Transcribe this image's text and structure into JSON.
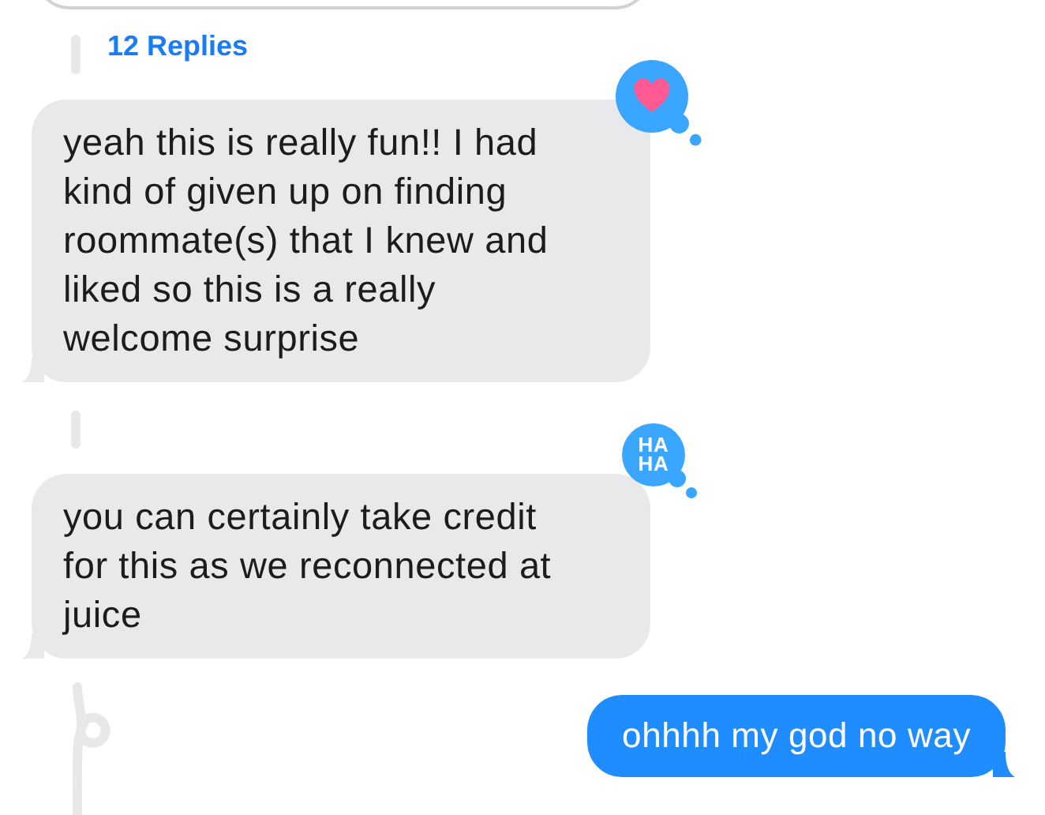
{
  "thread": {
    "replies_label": "12 Replies"
  },
  "messages": [
    {
      "kind": "received",
      "text": "yeah this is really fun!! I had kind of given up on finding roommate(s) that I knew and liked so this is a really welcome surprise",
      "tapback": {
        "kind": "heart"
      }
    },
    {
      "kind": "received",
      "text": "you can certainly take credit for this as we reconnected at juice",
      "tapback": {
        "kind": "haha",
        "lines": [
          "HA",
          "HA"
        ]
      }
    },
    {
      "kind": "sent",
      "text": "ohhhh my god no way"
    }
  ]
}
